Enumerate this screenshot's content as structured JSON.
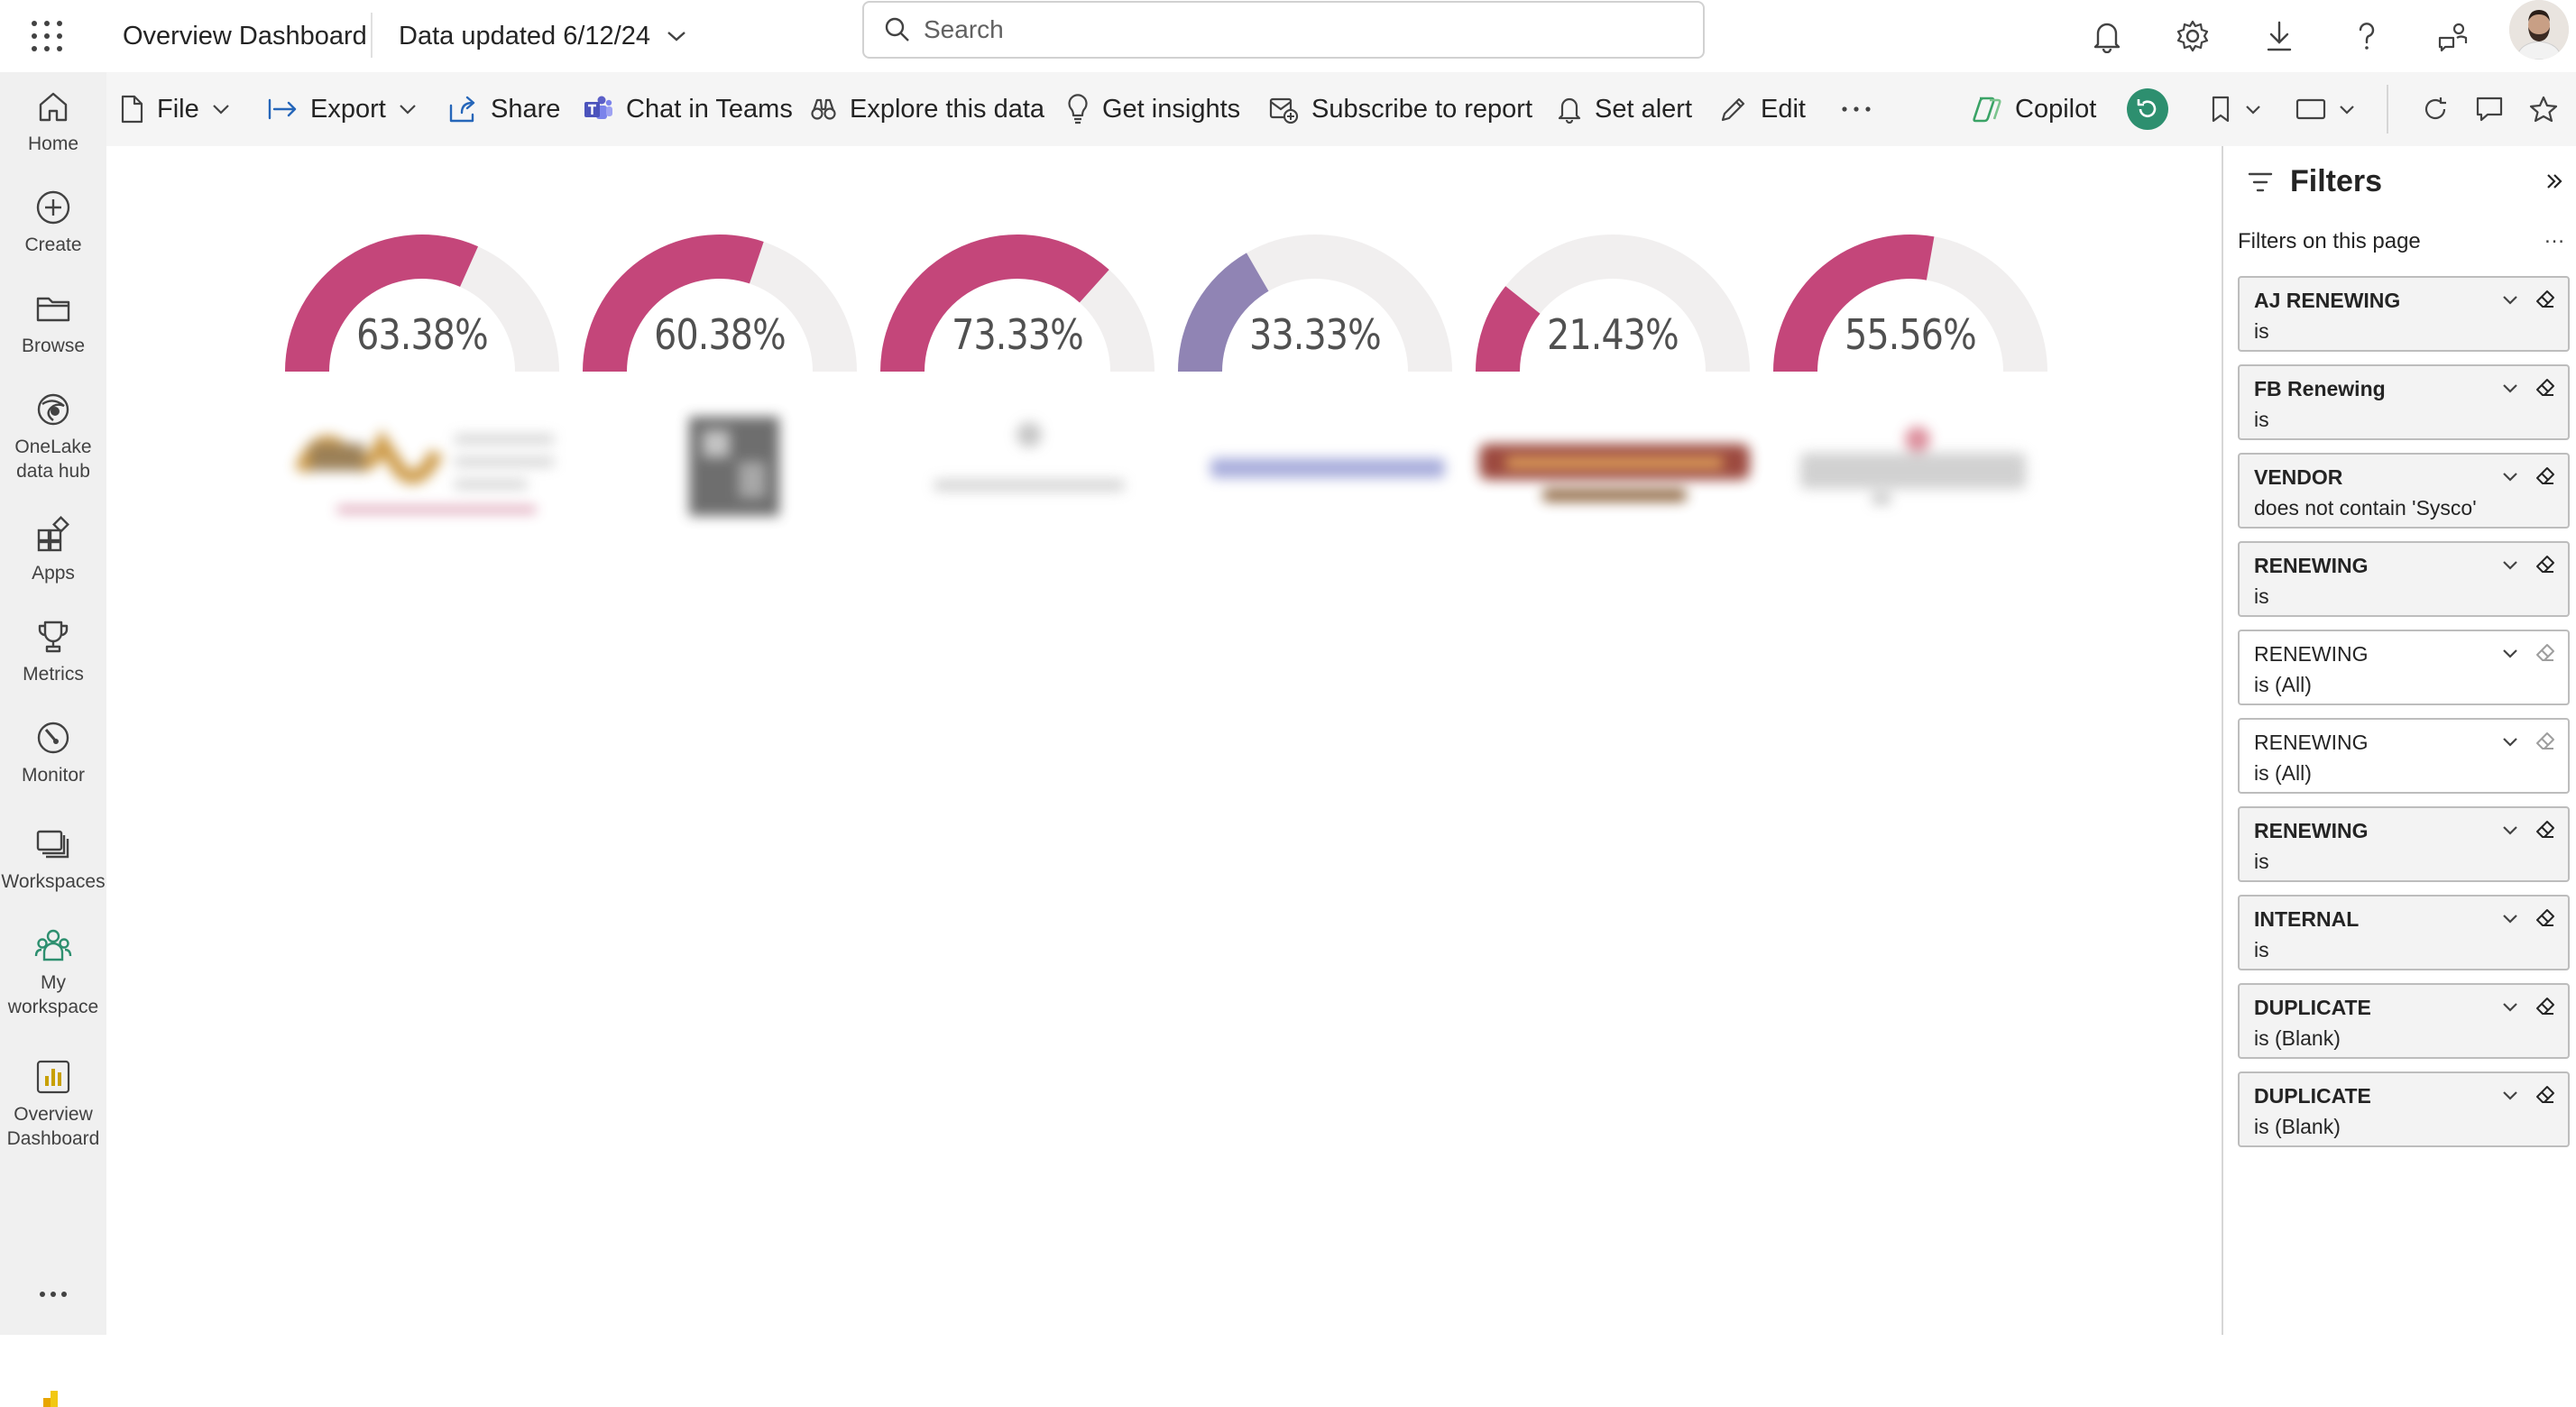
{
  "header": {
    "app_title": "Overview Dashboard",
    "data_updated": "Data updated 6/12/24",
    "search_placeholder": "Search"
  },
  "nav": {
    "items": [
      {
        "label": "Home",
        "icon": "home-icon"
      },
      {
        "label": "Create",
        "icon": "plus-circle-icon"
      },
      {
        "label": "Browse",
        "icon": "folder-icon"
      },
      {
        "label": "OneLake data hub",
        "icon": "onelake-icon"
      },
      {
        "label": "Apps",
        "icon": "apps-icon"
      },
      {
        "label": "Metrics",
        "icon": "trophy-icon"
      },
      {
        "label": "Monitor",
        "icon": "monitor-icon"
      },
      {
        "label": "Workspaces",
        "icon": "workspaces-icon"
      },
      {
        "label": "My workspace",
        "icon": "people-icon"
      },
      {
        "label": "Overview Dashboard",
        "icon": "report-icon"
      }
    ]
  },
  "toolbar": {
    "file": "File",
    "export": "Export",
    "share": "Share",
    "chat_in_teams": "Chat in Teams",
    "explore": "Explore this data",
    "insights": "Get insights",
    "subscribe": "Subscribe to report",
    "alert": "Set alert",
    "edit": "Edit",
    "copilot": "Copilot"
  },
  "gauges": [
    {
      "label": "63.38%",
      "value": 0.6338,
      "color": "#c4467a"
    },
    {
      "label": "60.38%",
      "value": 0.6038,
      "color": "#c4467a"
    },
    {
      "label": "73.33%",
      "value": 0.7333,
      "color": "#c4467a"
    },
    {
      "label": "33.33%",
      "value": 0.3333,
      "color": "#9084b4"
    },
    {
      "label": "21.43%",
      "value": 0.2143,
      "color": "#c4467a"
    },
    {
      "label": "55.56%",
      "value": 0.5556,
      "color": "#c4467a"
    }
  ],
  "gauge_track_color": "#f1efef",
  "filters": {
    "title": "Filters",
    "subtitle": "Filters on this page",
    "cards": [
      {
        "name": "AJ RENEWING",
        "value": "is",
        "active": true
      },
      {
        "name": "FB Renewing",
        "value": "is",
        "active": true
      },
      {
        "name": "VENDOR",
        "value": "does not contain 'Sysco'",
        "active": true
      },
      {
        "name": "RENEWING",
        "value": "is",
        "active": true
      },
      {
        "name": "RENEWING",
        "value": "is (All)",
        "active": false
      },
      {
        "name": "RENEWING",
        "value": "is (All)",
        "active": false
      },
      {
        "name": "RENEWING",
        "value": "is",
        "active": true
      },
      {
        "name": "INTERNAL",
        "value": "is",
        "active": true
      },
      {
        "name": "DUPLICATE",
        "value": "is (Blank)",
        "active": true
      },
      {
        "name": "DUPLICATE",
        "value": "is (Blank)",
        "active": true
      }
    ]
  },
  "colors": {
    "accent_green": "#2d8f6f",
    "nav_bg": "#f0f0f0",
    "toolbar_bg": "#f5f5f5"
  }
}
